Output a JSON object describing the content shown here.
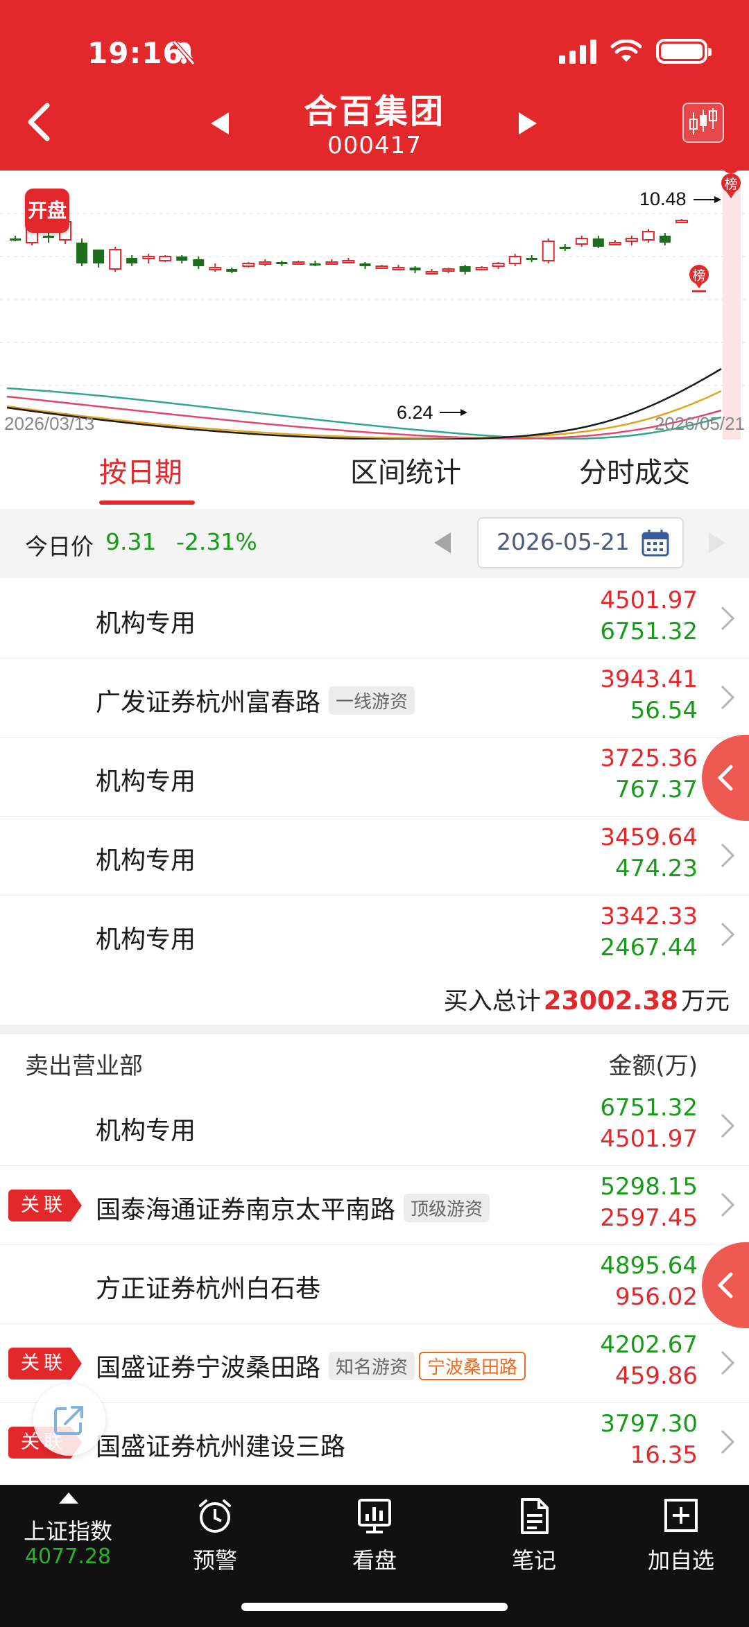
{
  "status_bar": {
    "time": "19:16"
  },
  "header": {
    "name": "合百集团",
    "code": "000417"
  },
  "kline": {
    "badge": "开盘",
    "start_date": "2026/03/13",
    "end_date": "2026/05/21",
    "high_label": "10.48",
    "low_label": "6.24",
    "rank_marker": "榜"
  },
  "tabs": [
    {
      "label": "按日期",
      "active": true
    },
    {
      "label": "区间统计",
      "active": false
    },
    {
      "label": "分时成交",
      "active": false
    }
  ],
  "price_bar": {
    "label": "今日价",
    "price": "9.31",
    "change": "-2.31%",
    "date": "2026-05-21"
  },
  "buy_list": [
    {
      "name": "机构专用",
      "tag": "",
      "top": "4501.97",
      "bottom": "6751.32"
    },
    {
      "name": "广发证券杭州富春路",
      "tag": "一线游资",
      "top": "3943.41",
      "bottom": "56.54"
    },
    {
      "name": "机构专用",
      "tag": "",
      "top": "3725.36",
      "bottom": "767.37"
    },
    {
      "name": "机构专用",
      "tag": "",
      "top": "3459.64",
      "bottom": "474.23"
    },
    {
      "name": "机构专用",
      "tag": "",
      "top": "3342.33",
      "bottom": "2467.44"
    }
  ],
  "buy_total": {
    "label": "买入总计",
    "value": "23002.38",
    "unit": "万元"
  },
  "sell_header": {
    "title": "卖出营业部",
    "amount": "金额(万)"
  },
  "related_label": "关联",
  "sell_list": [
    {
      "name": "机构专用",
      "tag": "",
      "tag2": "",
      "related": false,
      "top": "6751.32",
      "bottom": "4501.97"
    },
    {
      "name": "国泰海通证券南京太平南路",
      "tag": "顶级游资",
      "tag2": "",
      "related": true,
      "top": "5298.15",
      "bottom": "2597.45"
    },
    {
      "name": "方正证券杭州白石巷",
      "tag": "",
      "tag2": "",
      "related": false,
      "top": "4895.64",
      "bottom": "956.02"
    },
    {
      "name": "国盛证券宁波桑田路",
      "tag": "知名游资",
      "tag2": "宁波桑田路",
      "related": true,
      "top": "4202.67",
      "bottom": "459.86"
    },
    {
      "name": "国盛证券杭州建设三路",
      "tag": "",
      "tag2": "",
      "related": true,
      "top": "3797.30",
      "bottom": "16.35"
    }
  ],
  "bottom_nav": {
    "index_label": "上证指数",
    "index_value": "4077.28",
    "items": [
      {
        "label": "预警",
        "icon": "alarm-clock-icon"
      },
      {
        "label": "看盘",
        "icon": "monitor-chart-icon"
      },
      {
        "label": "笔记",
        "icon": "note-icon"
      },
      {
        "label": "加自选",
        "icon": "plus-box-icon"
      }
    ]
  },
  "colors": {
    "brand_red": "#e3282c",
    "up_red": "#e3282c",
    "down_green": "#1a9a1a",
    "tag_orange": "#ef6a1f"
  }
}
